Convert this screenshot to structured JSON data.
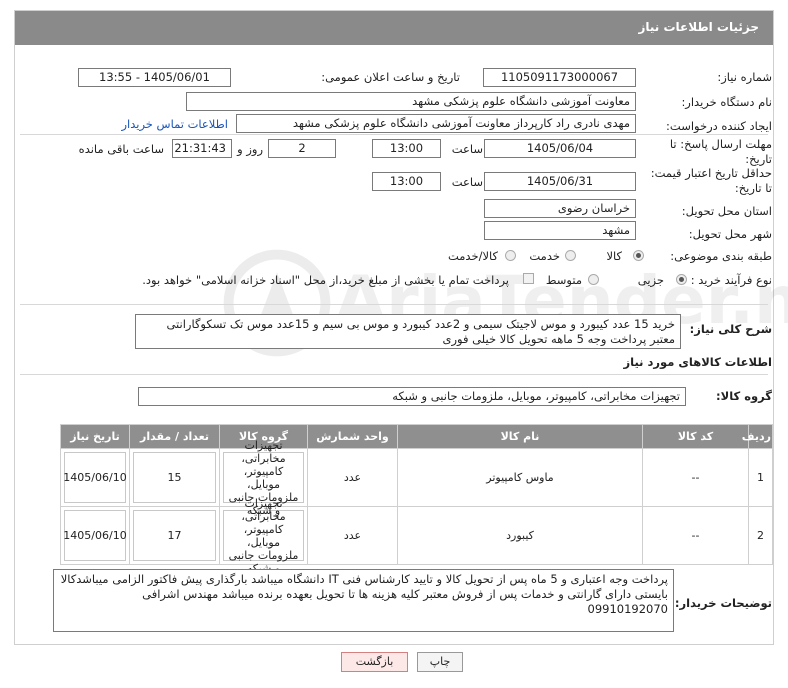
{
  "header": {
    "title": "جزئیات اطلاعات نیاز"
  },
  "form": {
    "need_number": {
      "label": "شماره نیاز:",
      "value": "1105091173000067"
    },
    "announce_date": {
      "label": "تاریخ و ساعت اعلان عمومی:",
      "value": "1405/06/01 - 13:55"
    },
    "buyer_org": {
      "label": "نام دستگاه خریدار:",
      "value": "معاونت آموزشی دانشگاه علوم پزشکی مشهد"
    },
    "requester": {
      "label": "ایجاد کننده درخواست:",
      "value": "مهدی نادری راد کارپرداز معاونت آموزشی دانشگاه علوم پزشکی مشهد",
      "contact_link": "اطلاعات تماس خریدار"
    },
    "reply_deadline": {
      "label_line1": "مهلت ارسال پاسخ: تا",
      "label_line2": "تاریخ:",
      "date": "1405/06/04",
      "time_label": "ساعت",
      "time": "13:00",
      "days": "2",
      "days_label": "روز و",
      "remaining": "21:31:43",
      "remaining_label": "ساعت باقی مانده"
    },
    "price_validity": {
      "label_line1": "حداقل تاریخ اعتبار قیمت:",
      "label_line2": "تا تاریخ:",
      "date": "1405/06/31",
      "time_label": "ساعت",
      "time": "13:00"
    },
    "delivery_province": {
      "label": "استان محل تحویل:",
      "value": "خراسان رضوی"
    },
    "delivery_city": {
      "label": "شهر محل تحویل:",
      "value": "مشهد"
    },
    "category": {
      "label": "طبقه بندی موضوعی:",
      "options": [
        "کالا",
        "خدمت",
        "کالا/خدمت"
      ],
      "selected": 0
    },
    "purchase_process": {
      "label": "نوع فرآیند خرید :",
      "options": [
        "جزیی",
        "متوسط"
      ],
      "selected": 0,
      "treasury_note": "پرداخت تمام یا بخشی از مبلغ خرید،از محل \"اسناد خزانه اسلامی\" خواهد بود."
    }
  },
  "description": {
    "label": "شرح کلی نیاز:",
    "text": "خرید 15 عدد کیبورد و موس لاجیتک سیمی و 2عدد کیبورد و موس بی سیم و 15عدد موس تک تسکوگارانتی معتبر پرداخت وجه 5 ماهه تحویل کالا خیلی فوری"
  },
  "items_section": {
    "title": "اطلاعات کالاهای مورد نیاز",
    "group_label": "گروه کالا:",
    "group_value": "تجهیزات مخابراتی، کامپیوتر، موبایل، ملزومات جانبی و شبکه",
    "columns": [
      "ردیف",
      "کد کالا",
      "نام کالا",
      "واحد شمارش",
      "گروه کالا",
      "تعداد / مقدار",
      "تاریخ نیاز"
    ],
    "rows": [
      {
        "index": "1",
        "code": "--",
        "name": "ماوس کامپیوتر",
        "unit": "عدد",
        "group": "تجهیزات مخابراتی، کامپیوتر، موبایل، ملزومات جانبی و شبکه",
        "qty": "15",
        "date": "1405/06/10"
      },
      {
        "index": "2",
        "code": "--",
        "name": "کیبورد",
        "unit": "عدد",
        "group": "تجهیزات مخابراتی، کامپیوتر، موبایل، ملزومات جانبی و شبکه",
        "qty": "17",
        "date": "1405/06/10"
      }
    ]
  },
  "buyer_notes": {
    "label": "توضیحات خریدار:",
    "text": "پرداخت وجه اعتباری و 5 ماه پس از تحویل کالا و تایید کارشناس فنی IT دانشگاه میباشد بارگذاری پیش فاکتور الزامی میباشدکالا بایستی دارای گارانتی و خدمات پس از فروش معتبر کلیه هزینه ها تا تحویل بعهده برنده میباشد مهندس اشرافی 09910192070"
  },
  "buttons": {
    "print": "چاپ",
    "back": "بازگشت"
  },
  "watermark": "AriaTender.net"
}
